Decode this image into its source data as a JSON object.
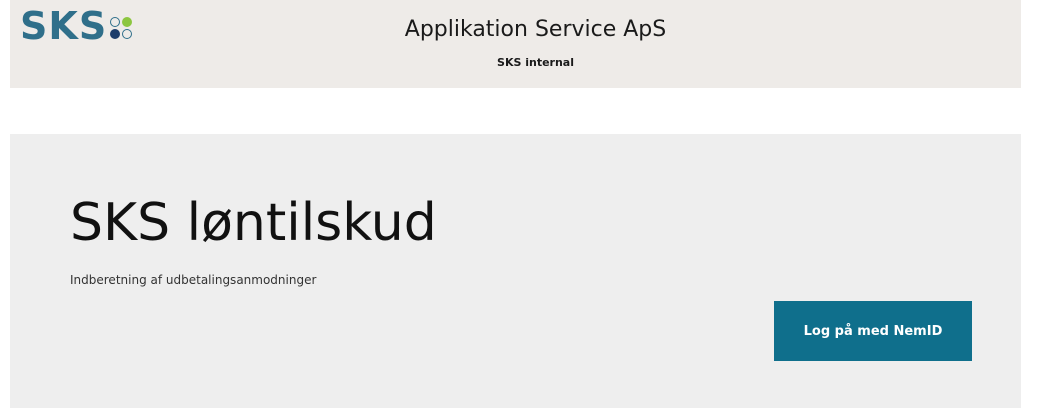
{
  "header": {
    "logo_text": "SKS",
    "title": "Applikation Service ApS",
    "subtitle": "SKS internal"
  },
  "colors": {
    "header_bg": "#eeebe8",
    "hero_bg": "#eeeeee",
    "logo_blue": "#2f6f8a",
    "logo_dark_blue": "#1d3d6b",
    "logo_green": "#8cc63f",
    "button_bg": "#0f6f8c"
  },
  "hero": {
    "title": "SKS løntilskud",
    "subtitle": "Indberetning af udbetalingsanmodninger",
    "login_button_label": "Log på med NemID"
  }
}
